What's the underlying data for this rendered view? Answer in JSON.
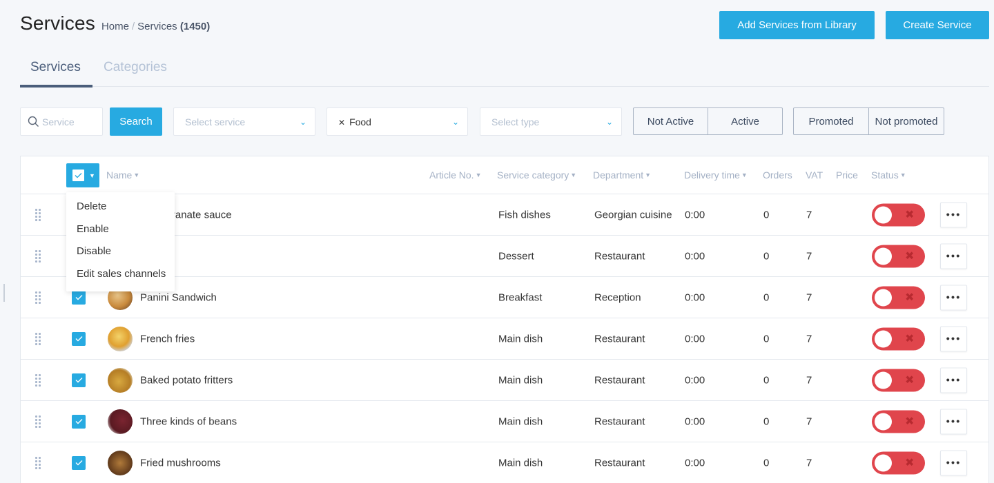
{
  "header": {
    "title": "Services",
    "breadcrumb": {
      "home": "Home",
      "separator": "/",
      "current": "Services",
      "count": "(1450)"
    },
    "buttons": {
      "add_library": "Add Services from Library",
      "create": "Create Service"
    }
  },
  "tabs": [
    {
      "label": "Services",
      "active": true
    },
    {
      "label": "Categories",
      "active": false
    }
  ],
  "filters": {
    "search_placeholder": "Service",
    "search_button": "Search",
    "select_service_placeholder": "Select service",
    "category_tag": "Food",
    "select_type_placeholder": "Select type",
    "status_options": [
      "Not Active",
      "Active"
    ],
    "promo_options": [
      "Promoted",
      "Not promoted"
    ]
  },
  "colors": {
    "accent": "#27aae1",
    "toggle_off": "#e0454c",
    "tab_active": "#4a5d7a"
  },
  "table": {
    "columns": {
      "name": "Name",
      "article": "Article No.",
      "category": "Service category",
      "department": "Department",
      "delivery": "Delivery time",
      "orders": "Orders",
      "vat": "VAT",
      "price": "Price",
      "status": "Status"
    },
    "bulk_menu": [
      "Delete",
      "Enable",
      "Disable",
      "Edit sales channels"
    ],
    "rows": [
      {
        "name": "pomegranate sauce",
        "category": "Fish dishes",
        "department": "Georgian cuisine",
        "delivery": "0:00",
        "orders": "0",
        "vat": "7",
        "price": "",
        "active": false,
        "checked": true
      },
      {
        "name": "",
        "category": "Dessert",
        "department": "Restaurant",
        "delivery": "0:00",
        "orders": "0",
        "vat": "7",
        "price": "",
        "active": false,
        "checked": true
      },
      {
        "name": "Panini Sandwich",
        "category": "Breakfast",
        "department": "Reception",
        "delivery": "0:00",
        "orders": "0",
        "vat": "7",
        "price": "",
        "active": false,
        "checked": true
      },
      {
        "name": "French fries",
        "category": "Main dish",
        "department": "Restaurant",
        "delivery": "0:00",
        "orders": "0",
        "vat": "7",
        "price": "",
        "active": false,
        "checked": true
      },
      {
        "name": "Baked potato fritters",
        "category": "Main dish",
        "department": "Restaurant",
        "delivery": "0:00",
        "orders": "0",
        "vat": "7",
        "price": "",
        "active": false,
        "checked": true
      },
      {
        "name": "Three kinds of beans",
        "category": "Main dish",
        "department": "Restaurant",
        "delivery": "0:00",
        "orders": "0",
        "vat": "7",
        "price": "",
        "active": false,
        "checked": true
      },
      {
        "name": "Fried mushrooms",
        "category": "Main dish",
        "department": "Restaurant",
        "delivery": "0:00",
        "orders": "0",
        "vat": "7",
        "price": "",
        "active": false,
        "checked": true
      }
    ],
    "icons": {
      "drag": "drag-handle-icon",
      "more": "more-dots-icon",
      "toggle_off": "close-x-icon"
    }
  }
}
